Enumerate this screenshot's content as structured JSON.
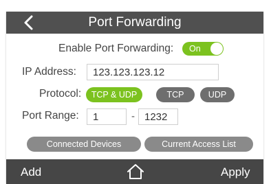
{
  "header": {
    "back_icon": "chevron-left-icon",
    "title": "Port Forwarding"
  },
  "form": {
    "enable_label": "Enable Port Forwarding:",
    "enable_toggle": {
      "label": "On",
      "state": true
    },
    "ip_label": "IP Address:",
    "ip_value": "123.123.123.12",
    "protocol_label": "Protocol:",
    "protocols": [
      {
        "label": "TCP & UDP",
        "selected": true
      },
      {
        "label": "TCP",
        "selected": false
      },
      {
        "label": "UDP",
        "selected": false
      }
    ],
    "port_range_label": "Port Range:",
    "port_start": "1",
    "port_separator": "-",
    "port_end": "1232",
    "connected_devices_label": "Connected Devices",
    "current_access_list_label": "Current Access List"
  },
  "footer": {
    "add_label": "Add",
    "home_icon": "home-icon",
    "apply_label": "Apply"
  },
  "colors": {
    "accent_green": "#7cc21f",
    "title_bar": "#505050",
    "bottom_bar": "#464646",
    "inactive_pill": "#6e6e6e",
    "gray_button": "#8a8a8a"
  }
}
